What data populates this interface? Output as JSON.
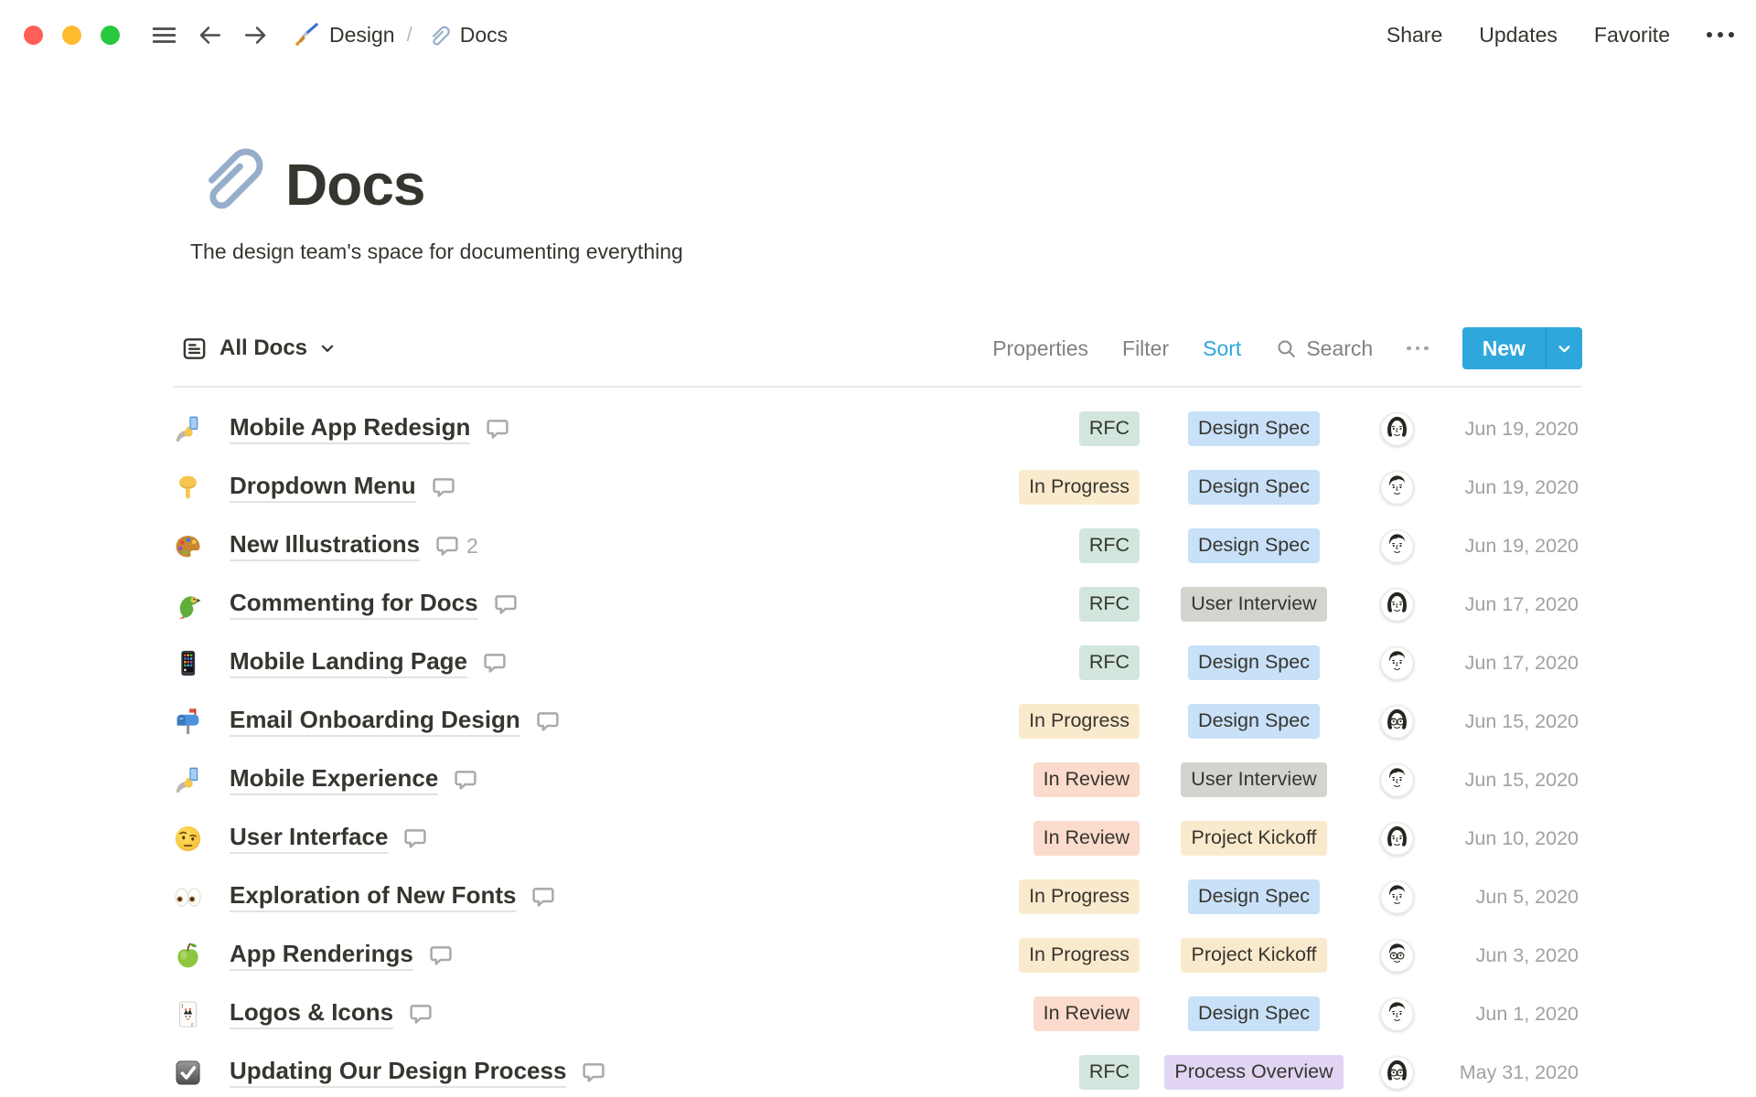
{
  "topbar": {
    "traffic_lights": [
      "#FF5F57",
      "#FEBC2E",
      "#28C840"
    ],
    "breadcrumb": [
      {
        "icon": "paintbrush-icon",
        "label": "Design"
      },
      {
        "icon": "paperclip-icon",
        "label": "Docs"
      }
    ],
    "breadcrumb_separator": "/",
    "actions": [
      {
        "label": "Share"
      },
      {
        "label": "Updates"
      },
      {
        "label": "Favorite"
      }
    ]
  },
  "page": {
    "icon": "paperclip-icon",
    "title": "Docs",
    "description": "The design team's space for documenting everything"
  },
  "toolbar": {
    "view": {
      "icon": "table-view-icon",
      "label": "All Docs"
    },
    "menu": {
      "properties": "Properties",
      "filter": "Filter",
      "sort": "Sort",
      "search": "Search"
    },
    "sort_active_color": "#2EA7DC",
    "new_button": {
      "label": "New",
      "color": "#2EA7DC"
    }
  },
  "colors": {
    "badge": {
      "green": "#D2E6DD",
      "blue": "#C8E0F8",
      "yellow": "#FAEACD",
      "red": "#FBDBCB",
      "gray": "#D4D3CE",
      "purple": "#E1D5F3"
    },
    "text": "#37352F",
    "muted": "#82817D",
    "date": "#A3A19D"
  },
  "table": {
    "rows": [
      {
        "icon": "selfie-emoji",
        "title": "Mobile App Redesign",
        "comments": null,
        "status": {
          "label": "RFC",
          "color": "green"
        },
        "type": {
          "label": "Design Spec",
          "color": "blue"
        },
        "avatar": "woman",
        "date": "Jun 19, 2020"
      },
      {
        "icon": "pointing-down-emoji",
        "title": "Dropdown Menu",
        "comments": null,
        "status": {
          "label": "In Progress",
          "color": "yellow"
        },
        "type": {
          "label": "Design Spec",
          "color": "blue"
        },
        "avatar": "man",
        "date": "Jun 19, 2020"
      },
      {
        "icon": "palette-emoji",
        "title": "New Illustrations",
        "comments": "2",
        "status": {
          "label": "RFC",
          "color": "green"
        },
        "type": {
          "label": "Design Spec",
          "color": "blue"
        },
        "avatar": "man",
        "date": "Jun 19, 2020"
      },
      {
        "icon": "parrot-emoji",
        "title": "Commenting for Docs",
        "comments": null,
        "status": {
          "label": "RFC",
          "color": "green"
        },
        "type": {
          "label": "User Interview",
          "color": "gray"
        },
        "avatar": "woman",
        "date": "Jun 17, 2020"
      },
      {
        "icon": "mobile-phone-emoji",
        "title": "Mobile Landing Page",
        "comments": null,
        "status": {
          "label": "RFC",
          "color": "green"
        },
        "type": {
          "label": "Design Spec",
          "color": "blue"
        },
        "avatar": "man",
        "date": "Jun 17, 2020"
      },
      {
        "icon": "mailbox-emoji",
        "title": "Email Onboarding Design",
        "comments": null,
        "status": {
          "label": "In Progress",
          "color": "yellow"
        },
        "type": {
          "label": "Design Spec",
          "color": "blue"
        },
        "avatar": "woman-glasses",
        "date": "Jun 15, 2020"
      },
      {
        "icon": "selfie-emoji",
        "title": "Mobile Experience",
        "comments": null,
        "status": {
          "label": "In Review",
          "color": "red"
        },
        "type": {
          "label": "User Interview",
          "color": "gray"
        },
        "avatar": "man",
        "date": "Jun 15, 2020"
      },
      {
        "icon": "raised-eyebrow-emoji",
        "title": "User Interface",
        "comments": null,
        "status": {
          "label": "In Review",
          "color": "red"
        },
        "type": {
          "label": "Project Kickoff",
          "color": "yellow"
        },
        "avatar": "woman",
        "date": "Jun 10, 2020"
      },
      {
        "icon": "eyes-emoji",
        "title": "Exploration of New Fonts",
        "comments": null,
        "status": {
          "label": "In Progress",
          "color": "yellow"
        },
        "type": {
          "label": "Design Spec",
          "color": "blue"
        },
        "avatar": "man",
        "date": "Jun 5, 2020"
      },
      {
        "icon": "green-apple-emoji",
        "title": "App Renderings",
        "comments": null,
        "status": {
          "label": "In Progress",
          "color": "yellow"
        },
        "type": {
          "label": "Project Kickoff",
          "color": "yellow"
        },
        "avatar": "man-glasses",
        "date": "Jun 3, 2020"
      },
      {
        "icon": "joker-card-emoji",
        "title": "Logos & Icons",
        "comments": null,
        "status": {
          "label": "In Review",
          "color": "red"
        },
        "type": {
          "label": "Design Spec",
          "color": "blue"
        },
        "avatar": "man",
        "date": "Jun 1, 2020"
      },
      {
        "icon": "checkbox-emoji",
        "title": "Updating Our Design Process",
        "comments": null,
        "status": {
          "label": "RFC",
          "color": "green"
        },
        "type": {
          "label": "Process Overview",
          "color": "purple"
        },
        "avatar": "woman-glasses",
        "date": "May 31, 2020"
      }
    ]
  }
}
